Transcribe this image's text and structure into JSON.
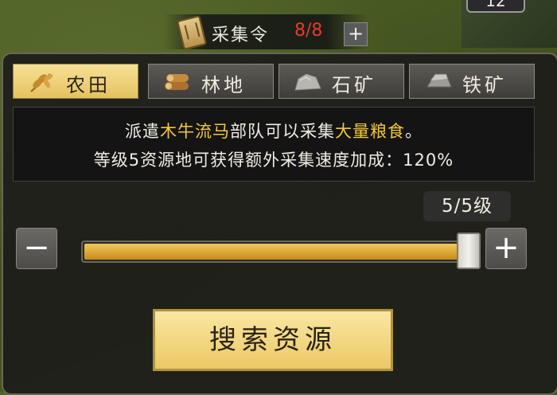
{
  "top_bar": {
    "label": "采集令",
    "count": "8/8",
    "plus": "+"
  },
  "top_counter": "12",
  "tabs": [
    {
      "label": "农田",
      "icon": "wheat-icon",
      "active": true
    },
    {
      "label": "林地",
      "icon": "logs-icon",
      "active": false
    },
    {
      "label": "石矿",
      "icon": "stone-icon",
      "active": false
    },
    {
      "label": "铁矿",
      "icon": "iron-ingot-icon",
      "active": false
    }
  ],
  "description": {
    "line1_pre": "派遣",
    "line1_troop": "木牛流马",
    "line1_mid": "部队可以采集",
    "line1_resource": "大量粮食",
    "line1_end": "。",
    "line2": "等级5资源地可获得额外采集速度加成：120%"
  },
  "level": {
    "text": "5/5级",
    "current": 5,
    "max": 5
  },
  "stepper": {
    "minus": "−",
    "plus": "+"
  },
  "search_button": "搜索资源",
  "colors": {
    "highlight": "#f2c83a",
    "count_red": "#e53a2a",
    "active_tab": "#f0d27a"
  }
}
